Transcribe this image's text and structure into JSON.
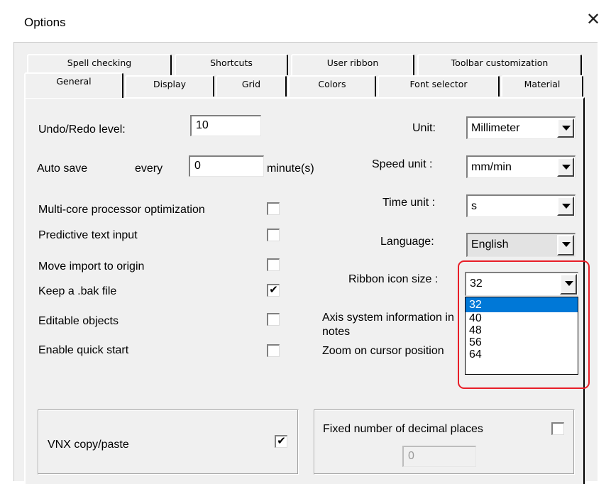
{
  "window": {
    "title": "Options",
    "close_glyph": "✕"
  },
  "tabs_back": [
    "Spell checking",
    "Shortcuts",
    "User ribbon",
    "Toolbar customization"
  ],
  "tabs_front": [
    "General",
    "Display",
    "Grid",
    "Colors",
    "Font selector",
    "Material"
  ],
  "active_tab": "General",
  "general": {
    "undo_label": "Undo/Redo level:",
    "undo_value": "10",
    "autosave_label": "Auto save",
    "every_label": "every",
    "autosave_value": "0",
    "minutes_label": "minute(s)",
    "checkboxes": [
      {
        "label": "Multi-core processor optimization",
        "checked": false
      },
      {
        "label": "Predictive text input",
        "checked": false
      },
      {
        "label": "Move import to origin",
        "checked": false
      },
      {
        "label": "Keep a .bak file",
        "checked": true
      },
      {
        "label": "Editable objects",
        "checked": false
      },
      {
        "label": "Enable quick start",
        "checked": false
      }
    ],
    "check_mark": "✔",
    "unit_label": "Unit:",
    "unit_value": "Millimeter",
    "speed_label": "Speed unit :",
    "speed_value": "mm/min",
    "time_label": "Time unit :",
    "time_value": "s",
    "language_label": "Language:",
    "language_value": "English",
    "ribbon_label": "Ribbon icon size :",
    "ribbon_value": "32",
    "ribbon_options": [
      "32",
      "40",
      "48",
      "56",
      "64"
    ],
    "axis_label_1": "Axis system information in",
    "axis_label_2": "notes",
    "zoom_label": "Zoom on cursor position",
    "vnx_label": "VNX copy/paste",
    "vnx_checked": true,
    "fixed_label": "Fixed number of decimal places",
    "fixed_checked": false,
    "fixed_value": "0"
  },
  "colors": {
    "highlight": "#e81e27",
    "selection": "#0078d7"
  }
}
